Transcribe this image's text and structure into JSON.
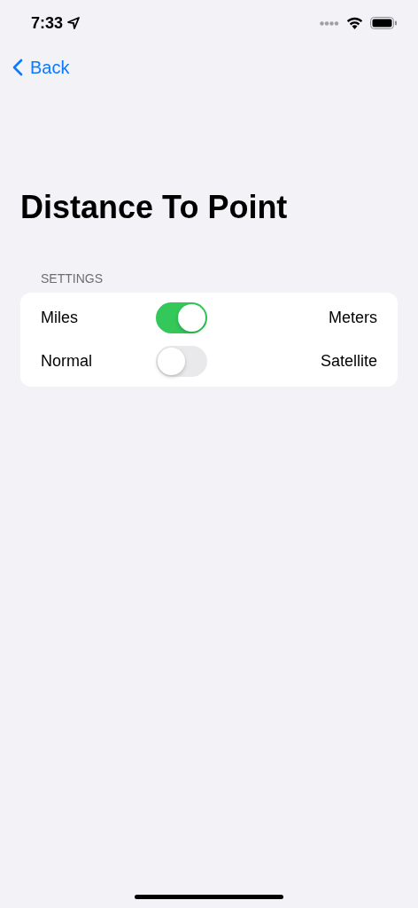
{
  "status_bar": {
    "time": "7:33"
  },
  "nav": {
    "back": "Back"
  },
  "title": "Distance To Point",
  "section": {
    "header": "SETTINGS",
    "rows": [
      {
        "left": "Miles",
        "right": "Meters",
        "on": true
      },
      {
        "left": "Normal",
        "right": "Satellite",
        "on": false
      }
    ]
  }
}
